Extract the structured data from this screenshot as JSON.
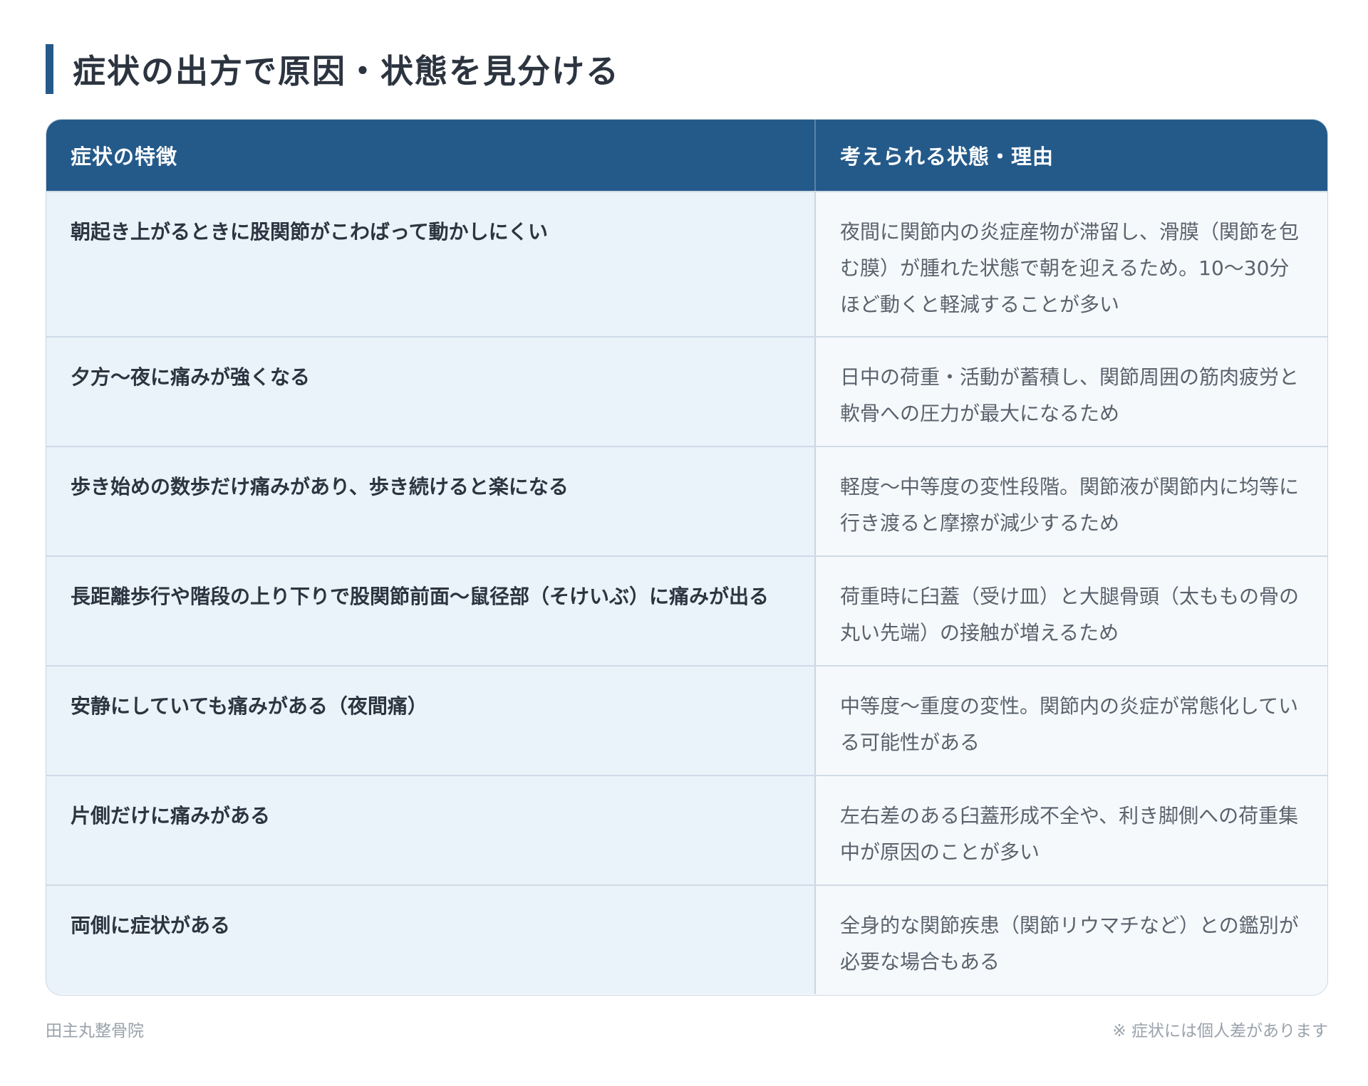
{
  "title": "症状の出方で原因・状態を見分ける",
  "table": {
    "headers": [
      "症状の特徴",
      "考えられる状態・理由"
    ],
    "rows": [
      {
        "symptom": "朝起き上がるときに股関節がこわばって動かしにくい",
        "reason": "夜間に関節内の炎症産物が滞留し、滑膜（関節を包む膜）が腫れた状態で朝を迎えるため。10〜30分ほど動くと軽減することが多い"
      },
      {
        "symptom": "夕方〜夜に痛みが強くなる",
        "reason": "日中の荷重・活動が蓄積し、関節周囲の筋肉疲労と軟骨への圧力が最大になるため"
      },
      {
        "symptom": "歩き始めの数歩だけ痛みがあり、歩き続けると楽になる",
        "reason": "軽度〜中等度の変性段階。関節液が関節内に均等に行き渡ると摩擦が減少するため"
      },
      {
        "symptom": "長距離歩行や階段の上り下りで股関節前面〜鼠径部（そけいぶ）に痛みが出る",
        "reason": "荷重時に臼蓋（受け皿）と大腿骨頭（太ももの骨の丸い先端）の接触が増えるため"
      },
      {
        "symptom": "安静にしていても痛みがある（夜間痛）",
        "reason": "中等度〜重度の変性。関節内の炎症が常態化している可能性がある"
      },
      {
        "symptom": "片側だけに痛みがある",
        "reason": "左右差のある臼蓋形成不全や、利き脚側への荷重集中が原因のことが多い"
      },
      {
        "symptom": "両側に症状がある",
        "reason": "全身的な関節疾患（関節リウマチなど）との鑑別が必要な場合もある"
      }
    ]
  },
  "footer": {
    "clinic": "田主丸整骨院",
    "note": "※ 症状には個人差があります"
  },
  "colors": {
    "accent": "#245a8a",
    "symptom_bg": "#eaf2fa",
    "reason_bg": "#f6f9fc"
  }
}
